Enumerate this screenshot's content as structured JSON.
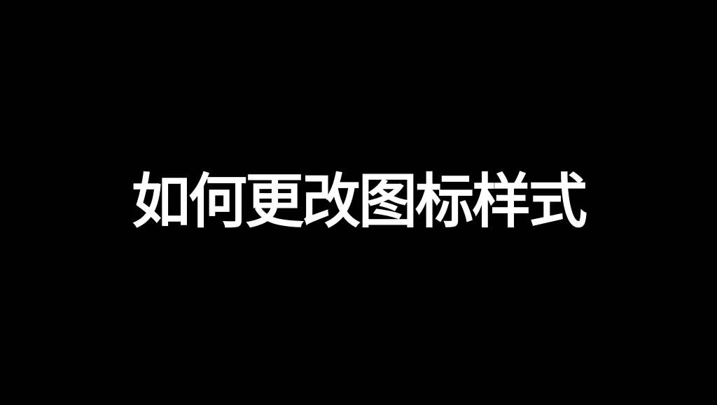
{
  "screen": {
    "title": "如何更改图标样式",
    "background_color": "#000000",
    "text_color": "#ffffff"
  }
}
